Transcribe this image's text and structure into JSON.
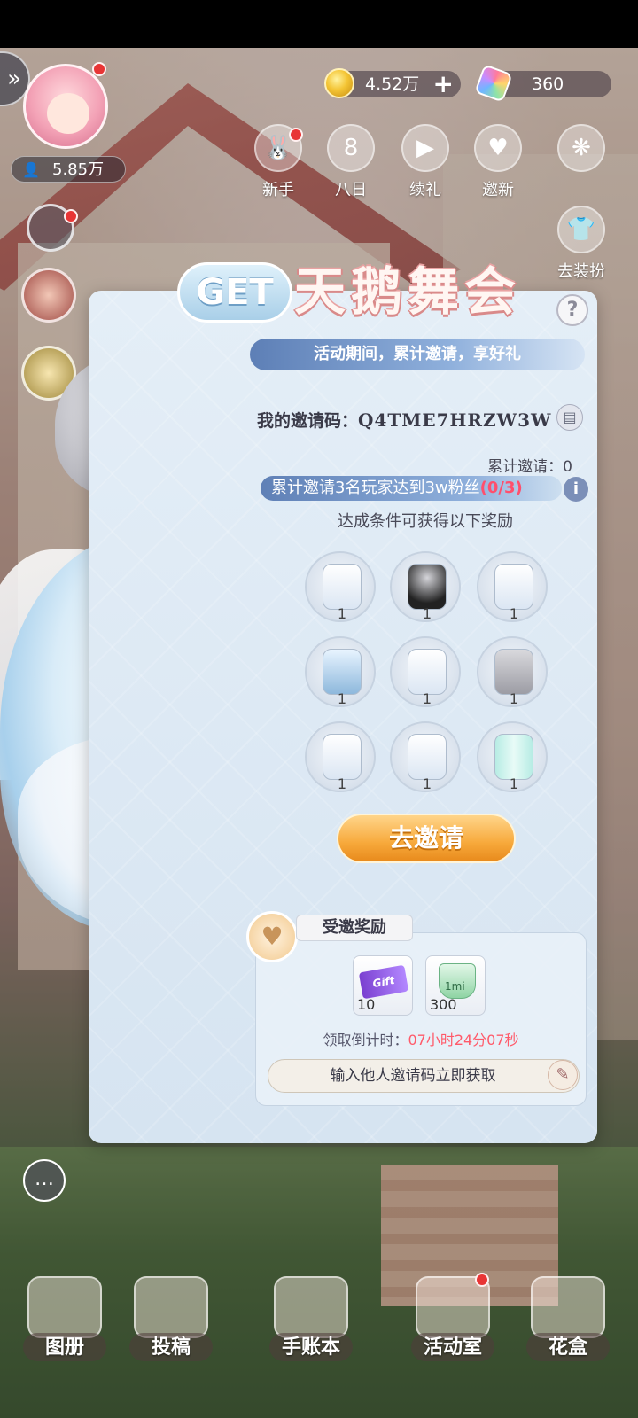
{
  "header": {
    "fans": "5.85万",
    "coins": "4.52万",
    "gems": "360"
  },
  "top_icons": [
    {
      "label": "新手",
      "icon": "rabbit-icon"
    },
    {
      "label": "八日",
      "icon": "eight-icon"
    },
    {
      "label": "续礼",
      "icon": "video-icon"
    },
    {
      "label": "邀新",
      "icon": "hearts-icon"
    }
  ],
  "side_icons": {
    "dress_label": "去装扮"
  },
  "event": {
    "get_badge": "GET",
    "title": "天鹅舞会",
    "subtitle": "活动期间，累计邀请，享好礼",
    "invite_code_label": "我的邀请码：",
    "invite_code": "Q4TME7HRZW3W",
    "accumulated_label": "累计邀请：0",
    "progress_text": "累计邀请3名玩家达到3w粉丝",
    "progress_count": "(0/3)",
    "reward_note": "达成条件可获得以下奖励",
    "rewards": [
      {
        "name": "swan-dress",
        "qty": "1"
      },
      {
        "name": "silver-hair",
        "qty": "1"
      },
      {
        "name": "feather-tiara",
        "qty": "1"
      },
      {
        "name": "crystal-heels",
        "qty": "1"
      },
      {
        "name": "pearl-hairpins",
        "qty": "1"
      },
      {
        "name": "silver-boots",
        "qty": "1"
      },
      {
        "name": "feather-corsage",
        "qty": "1"
      },
      {
        "name": "white-wings",
        "qty": "1"
      },
      {
        "name": "crystal-wings",
        "qty": "1"
      }
    ],
    "go_invite": "去邀请"
  },
  "invited_reward": {
    "tab_label": "受邀奖励",
    "items": [
      {
        "name": "gift-ticket",
        "label": "Gift",
        "qty": "10"
      },
      {
        "name": "gem-cake",
        "label": "1mi",
        "qty": "300"
      }
    ],
    "countdown_label": "领取倒计时：",
    "countdown_time": "07小时24分07秒",
    "code_input_text": "输入他人邀请码立即获取"
  },
  "bottom_nav": [
    {
      "label": "图册"
    },
    {
      "label": "投稿"
    },
    {
      "label": "手账本"
    },
    {
      "label": "活动室"
    },
    {
      "label": "花盒"
    }
  ],
  "colors": {
    "panel_bg": "#d6e4f1",
    "accent_blue": "#5d7fb6",
    "button_orange": "#f7a93b",
    "progress_count": "#ff4f6d",
    "countdown_time": "#ff5a6a"
  }
}
